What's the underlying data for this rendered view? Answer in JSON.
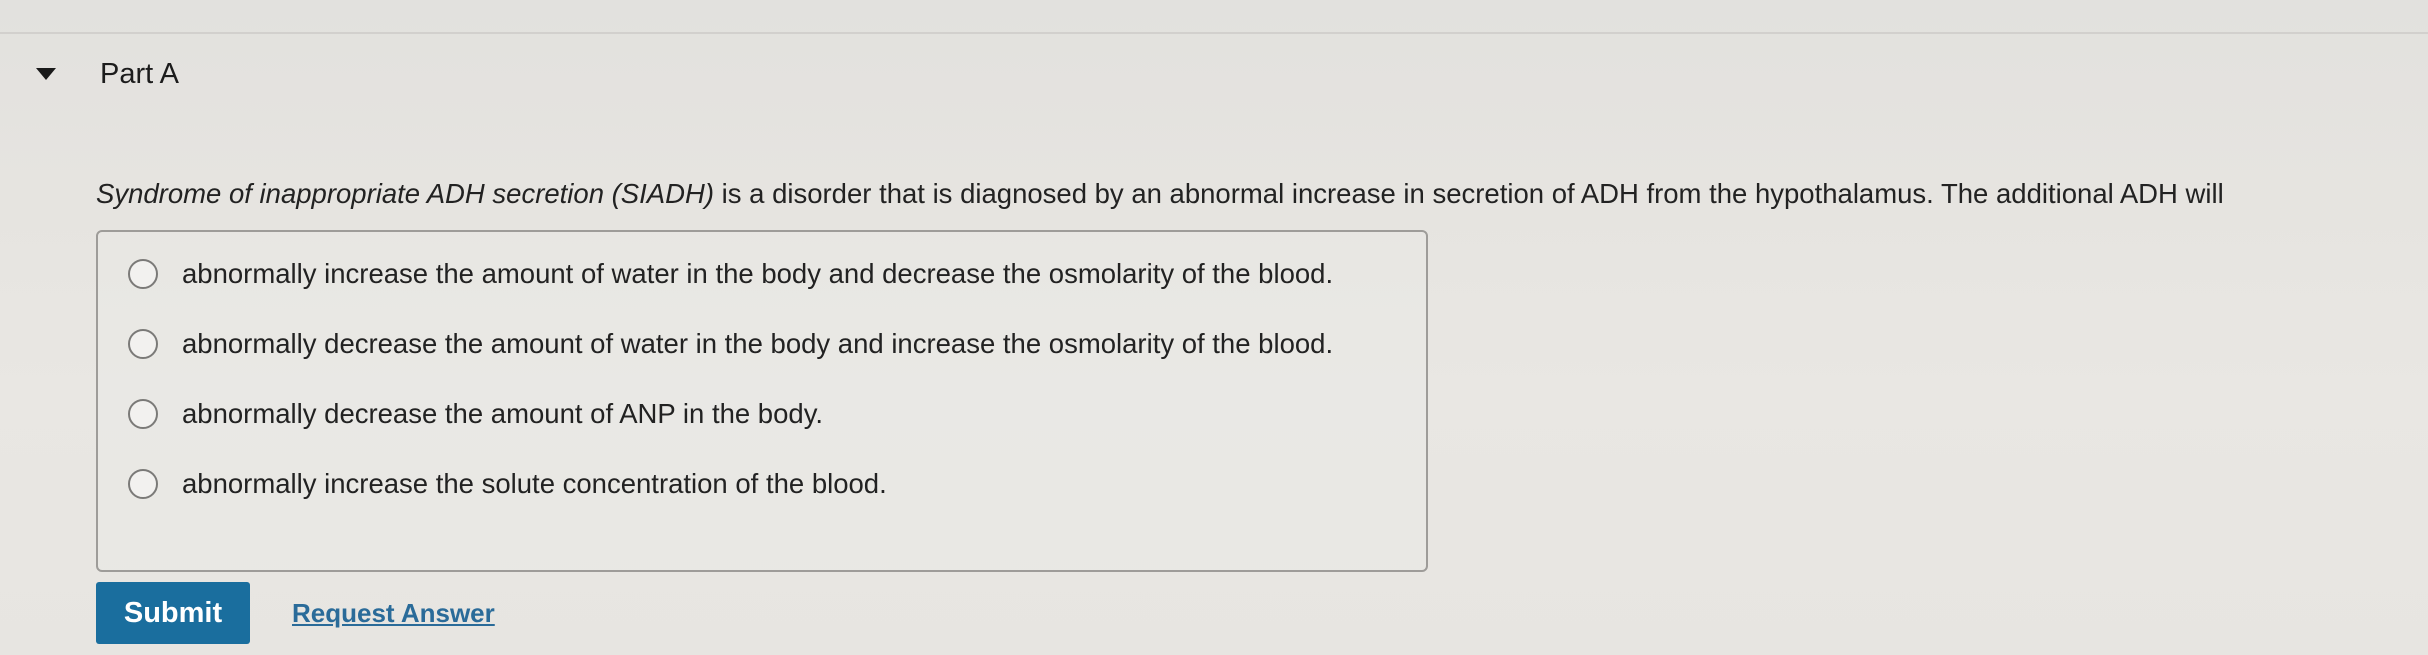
{
  "part": {
    "title": "Part A",
    "caret_icon": "caret-down-icon"
  },
  "question": {
    "term": "Syndrome of inappropriate ADH secretion (SIADH)",
    "text": " is a disorder that is diagnosed by an abnormal increase in secretion of ADH from the hypothalamus. The additional ADH will"
  },
  "options": [
    {
      "label": "abnormally increase the amount of water in the body and decrease the osmolarity of the blood.",
      "selected": false
    },
    {
      "label": "abnormally decrease the amount of water in the body and increase the osmolarity of the blood.",
      "selected": false
    },
    {
      "label": "abnormally decrease the amount of ANP in the body.",
      "selected": false
    },
    {
      "label": "abnormally increase the solute concentration of the blood.",
      "selected": false
    }
  ],
  "actions": {
    "submit_label": "Submit",
    "request_answer_label": "Request Answer"
  },
  "colors": {
    "submit_button": "#1a6e9e",
    "link": "#2a6b99"
  }
}
